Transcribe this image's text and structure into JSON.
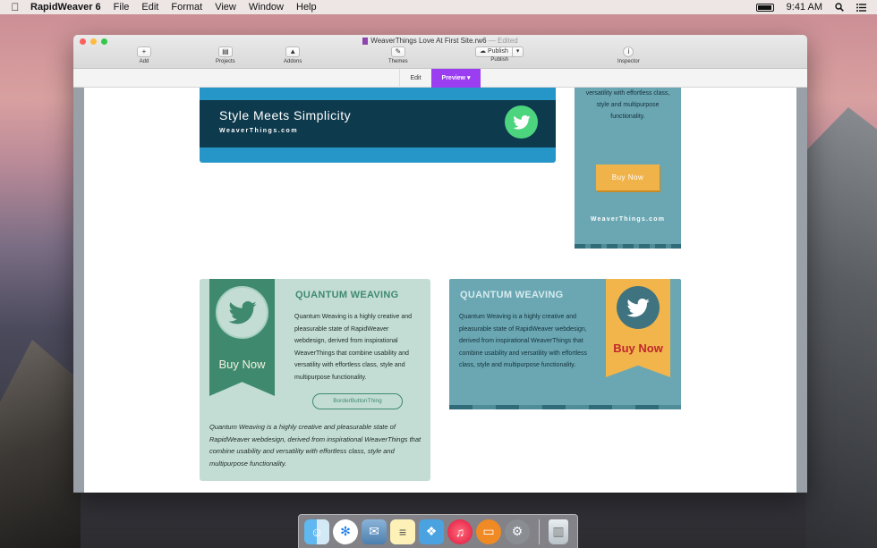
{
  "menubar": {
    "app_name": "RapidWeaver 6",
    "items": [
      "File",
      "Edit",
      "Format",
      "View",
      "Window",
      "Help"
    ],
    "time": "9:41 AM"
  },
  "window": {
    "title": "WeaverThings Love At First Site.rw6",
    "title_status": "Edited",
    "toolbar": {
      "add": "Add",
      "projects": "Projects",
      "addons": "Addons",
      "themes": "Themes",
      "publish_button": "Publish",
      "publish": "Publish",
      "inspector": "Inspector"
    },
    "tabs": {
      "edit": "Edit",
      "preview": "Preview"
    }
  },
  "page": {
    "banner": {
      "title": "Style Meets Simplicity",
      "subtitle": "WeaverThings.com"
    },
    "right_box": {
      "text": "versatility with effortless class, style and multipurpose functionality.",
      "buy": "Buy Now",
      "site": "WeaverThings.com"
    },
    "card1": {
      "buy": "Buy Now",
      "heading": "QUANTUM WEAVING",
      "body": "Quantum Weaving is a highly creative and pleasurable state of RapidWeaver webdesign, derived from inspirational WeaverThings that combine usability and versatility with effortless class, style and multipurpose functionality.",
      "button": "BorderButtonThing",
      "italic": "Quantum Weaving is a highly creative and pleasurable state of RapidWeaver webdesign, derived from inspirational WeaverThings that combine usability and versatility with effortless class, style and multipurpose functionality."
    },
    "card2": {
      "heading": "QUANTUM WEAVING",
      "body": "Quantum Weaving is a highly creative and pleasurable state of RapidWeaver webdesign, derived from inspirational WeaverThings that combine usability and versatility with effortless class, style and multipurpose functionality.",
      "buy": "Buy Now"
    }
  },
  "colors": {
    "preview_tab": "#9b3df0",
    "banner_blue": "#2696c8",
    "banner_dark": "#0e3a4d",
    "twitter_green": "#4cd47f",
    "teal": "#6aa7b3",
    "mint": "#c3ddd5",
    "ribbon_green": "#3f8a6f",
    "orange": "#f2b54c",
    "buy_red": "#c0272d"
  },
  "dock": {
    "icons": [
      "finder-icon",
      "safari-icon",
      "mail-icon",
      "notes-icon",
      "rapidweaver-icon",
      "itunes-icon",
      "ibooks-icon",
      "system-preferences-icon",
      "trash-icon"
    ]
  }
}
